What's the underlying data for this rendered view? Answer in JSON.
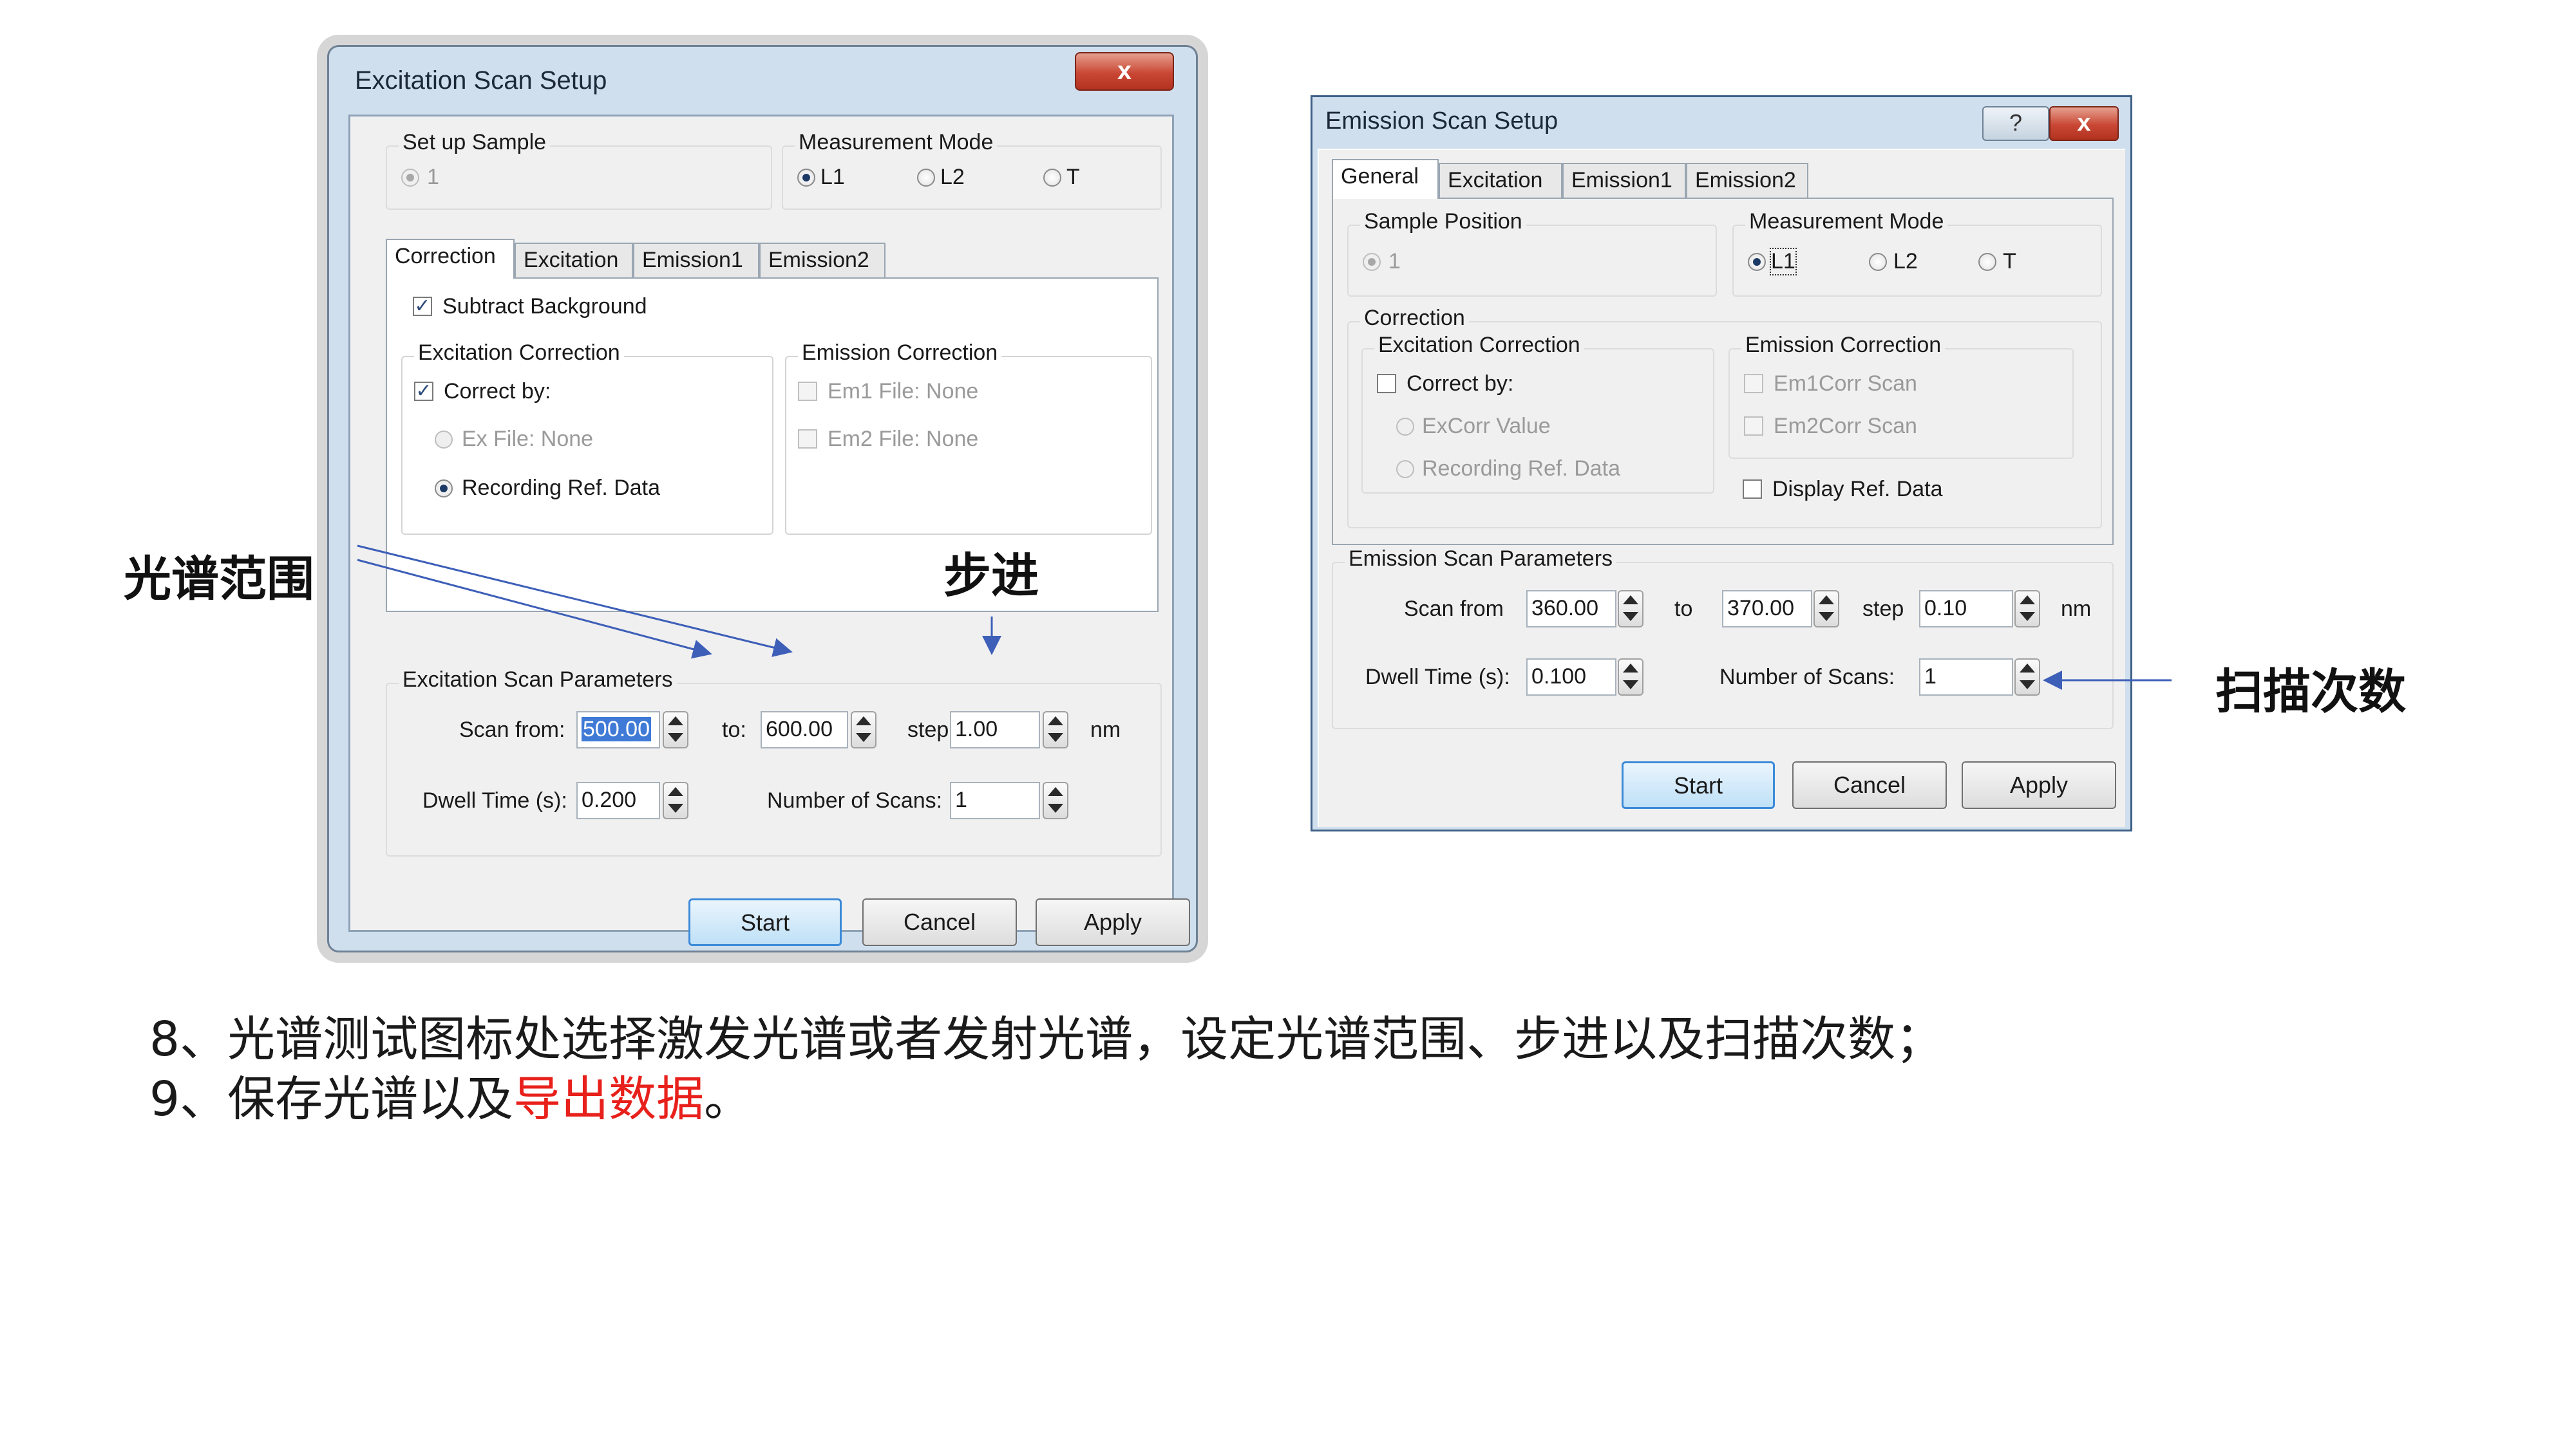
{
  "excitation_dialog": {
    "title": "Excitation Scan Setup",
    "close_label": "x",
    "setup_sample": {
      "label": "Set up Sample",
      "option": "1"
    },
    "measurement_mode": {
      "label": "Measurement Mode",
      "options": [
        "L1",
        "L2",
        "T"
      ],
      "selected": "L1"
    },
    "tabs": [
      "Correction",
      "Excitation",
      "Emission1",
      "Emission2"
    ],
    "active_tab": "Correction",
    "subtract_background": "Subtract Background",
    "excitation_correction": {
      "label": "Excitation Correction",
      "correct_by": "Correct by:",
      "ex_file": "Ex File: None",
      "recording_ref": "Recording Ref. Data"
    },
    "emission_correction": {
      "label": "Emission Correction",
      "em1_file": "Em1 File: None",
      "em2_file": "Em2 File: None"
    },
    "scan_parameters": {
      "label": "Excitation Scan Parameters",
      "scan_from_label": "Scan from:",
      "scan_from": "500.00",
      "to_label": "to:",
      "to": "600.00",
      "step_label": "step:",
      "step": "1.00",
      "unit": "nm",
      "dwell_label": "Dwell Time (s):",
      "dwell": "0.200",
      "scans_label": "Number of Scans:",
      "scans": "1"
    },
    "buttons": {
      "start": "Start",
      "cancel": "Cancel",
      "apply": "Apply"
    }
  },
  "emission_dialog": {
    "title": "Emission Scan Setup",
    "help_label": "?",
    "close_label": "x",
    "tabs": [
      "General",
      "Excitation",
      "Emission1",
      "Emission2"
    ],
    "active_tab": "General",
    "sample_position": {
      "label": "Sample Position",
      "option": "1"
    },
    "measurement_mode": {
      "label": "Measurement Mode",
      "options": [
        "L1",
        "L2",
        "T"
      ],
      "selected": "L1"
    },
    "correction": {
      "label": "Correction",
      "excitation_correction": "Excitation Correction",
      "correct_by": "Correct by:",
      "excorr_value": "ExCorr Value",
      "recording_ref": "Recording Ref. Data",
      "emission_correction": "Emission Correction",
      "em1corr": "Em1Corr Scan",
      "em2corr": "Em2Corr Scan",
      "display_ref": "Display Ref. Data"
    },
    "scan_parameters": {
      "label": "Emission Scan Parameters",
      "scan_from_label": "Scan from",
      "scan_from": "360.00",
      "to_label": "to",
      "to": "370.00",
      "step_label": "step",
      "step": "0.10",
      "unit": "nm",
      "dwell_label": "Dwell Time (s):",
      "dwell": "0.100",
      "scans_label": "Number of Scans:",
      "scans": "1"
    },
    "buttons": {
      "start": "Start",
      "cancel": "Cancel",
      "apply": "Apply"
    }
  },
  "annotations": {
    "spectral_range": "光谱范围",
    "step": "步进",
    "scan_count": "扫描次数"
  },
  "instructions": {
    "line1": "8、光谱测试图标处选择激发光谱或者发射光谱，设定光谱范围、步进以及扫描次数；",
    "line2_prefix": "9、保存光谱以及",
    "line2_highlight": "导出数据",
    "line2_suffix": "。"
  },
  "colors": {
    "highlight": "#e8201b",
    "arrow": "#3d5fb8"
  }
}
